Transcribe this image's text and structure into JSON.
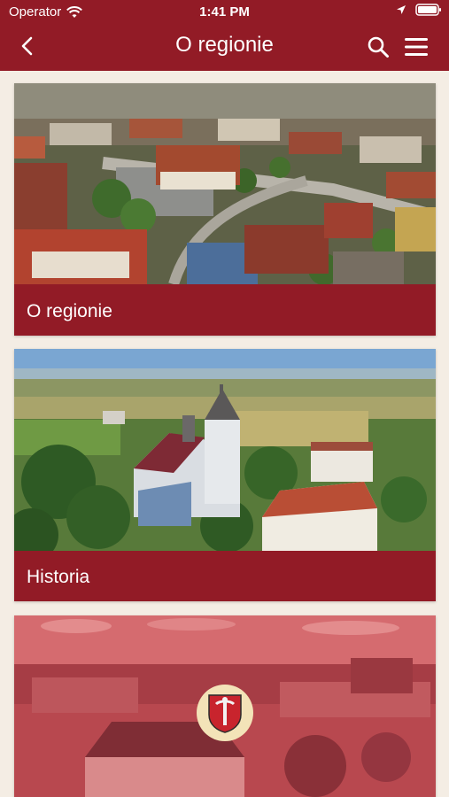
{
  "status_bar": {
    "carrier": "Operator",
    "time": "1:41 PM"
  },
  "header": {
    "title": "O regionie"
  },
  "cards": [
    {
      "label": "O regionie",
      "image": "aerial-town-photo"
    },
    {
      "label": "Historia",
      "image": "aerial-church-photo"
    },
    {
      "label": "",
      "image": "town-square-photo-with-coat-of-arms"
    }
  ],
  "colors": {
    "primary": "#921b26",
    "background": "#f4ede4",
    "emblem_bg": "#f3e3b8"
  }
}
